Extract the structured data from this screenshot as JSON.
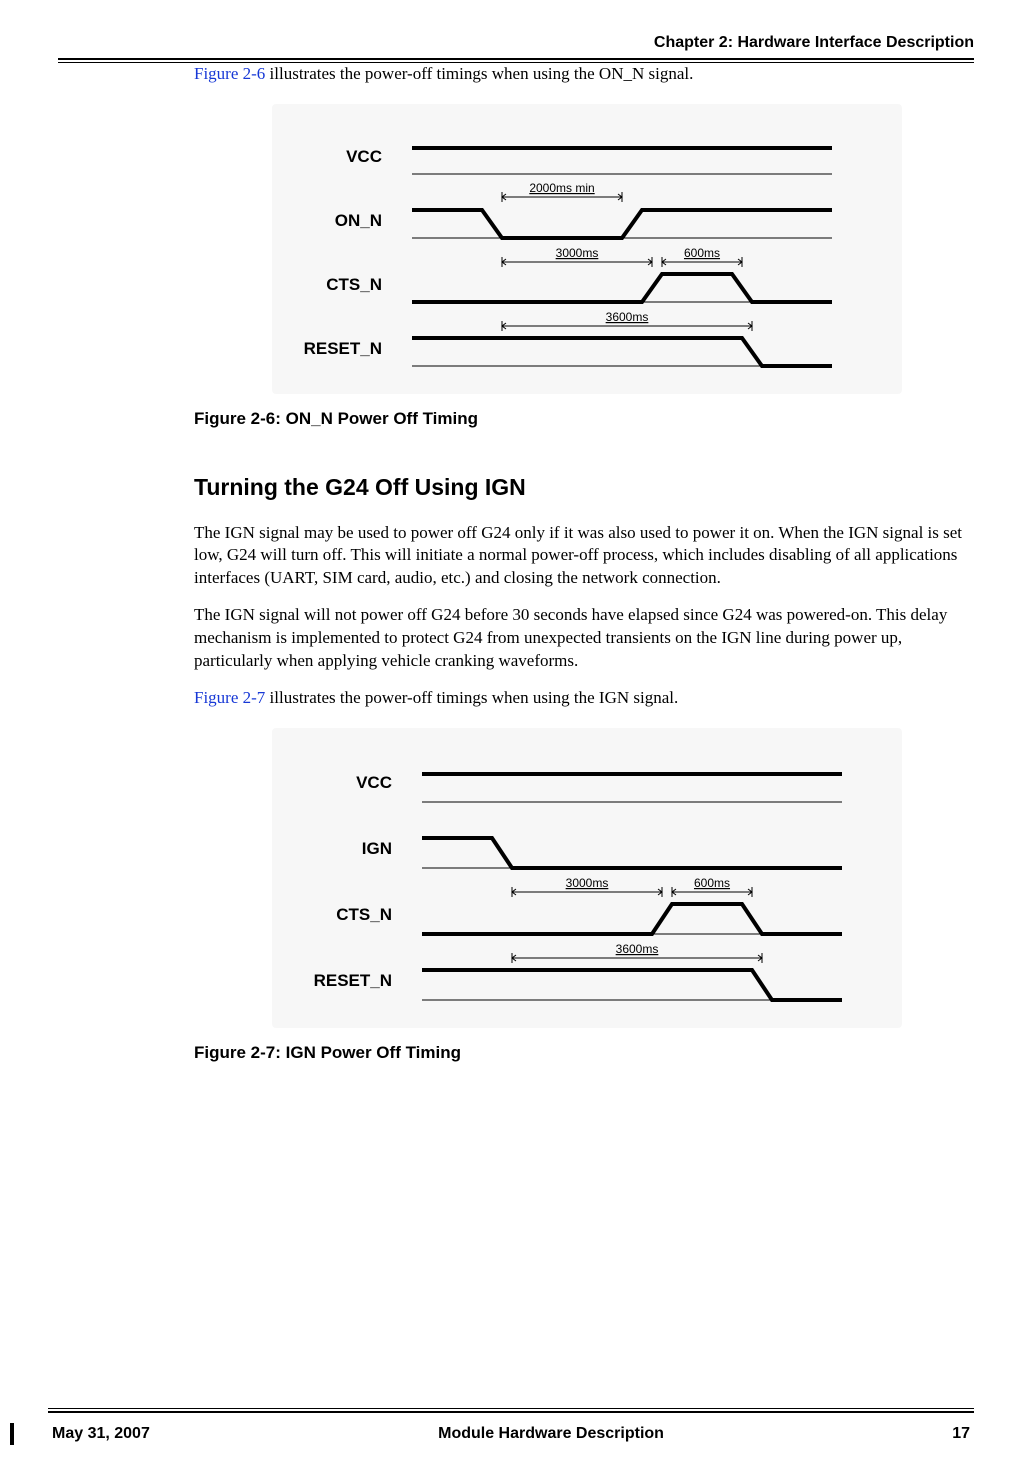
{
  "header": {
    "chapter_label": "Chapter 2:  Hardware Interface Description"
  },
  "intro1": {
    "link": "Figure 2-6",
    "rest": " illustrates the power-off timings when using the ON_N signal."
  },
  "fig26": {
    "caption": "Figure 2-6: ON_N Power Off Timing",
    "signals": [
      "VCC",
      "ON_N",
      "CTS_N",
      "RESET_N"
    ],
    "timings": [
      "2000ms min",
      "3000ms",
      "600ms",
      "3600ms"
    ]
  },
  "section": {
    "title": "Turning the G24 Off Using IGN",
    "p1": "The IGN signal may be used to power off G24 only if it was also used to power it on. When the IGN signal is set low, G24 will turn off. This will initiate a normal power-off process, which includes disabling of all applications interfaces (UART, SIM card, audio, etc.) and closing the network connection.",
    "p2": "The IGN signal will not power off G24 before 30 seconds have elapsed since G24 was powered-on. This delay mechanism is implemented to protect G24 from unexpected transients on the IGN line during power up, particularly when applying vehicle cranking waveforms."
  },
  "intro2": {
    "link": "Figure 2-7",
    "rest": " illustrates the power-off timings when using the IGN signal."
  },
  "fig27": {
    "caption": "Figure 2-7: IGN Power Off Timing",
    "signals": [
      "VCC",
      "IGN",
      "CTS_N",
      "RESET_N"
    ],
    "timings": [
      "3000ms",
      "600ms",
      "3600ms"
    ]
  },
  "footer": {
    "date": "May 31, 2007",
    "title": "Module Hardware Description",
    "page": "17"
  },
  "chart_data": [
    {
      "type": "timing-diagram",
      "title": "ON_N Power Off Timing",
      "signals": [
        {
          "name": "VCC",
          "level": "high-constant"
        },
        {
          "name": "ON_N",
          "events": [
            {
              "t": 0,
              "level": "high"
            },
            {
              "t": 1,
              "level": "low",
              "duration_label": "2000ms min"
            },
            {
              "t": 2,
              "level": "high"
            }
          ]
        },
        {
          "name": "CTS_N",
          "events": [
            {
              "t": 0,
              "level": "low"
            },
            {
              "from": "ON_N-fall",
              "delay_label": "3000ms",
              "level": "high",
              "duration_label": "600ms"
            },
            {
              "level": "low"
            }
          ]
        },
        {
          "name": "RESET_N",
          "events": [
            {
              "t": 0,
              "level": "high"
            },
            {
              "from": "ON_N-fall",
              "delay_label": "3600ms",
              "level": "low"
            }
          ]
        }
      ]
    },
    {
      "type": "timing-diagram",
      "title": "IGN Power Off Timing",
      "signals": [
        {
          "name": "VCC",
          "level": "high-constant"
        },
        {
          "name": "IGN",
          "events": [
            {
              "t": 0,
              "level": "high"
            },
            {
              "t": 1,
              "level": "low"
            }
          ]
        },
        {
          "name": "CTS_N",
          "events": [
            {
              "t": 0,
              "level": "low"
            },
            {
              "from": "IGN-fall",
              "delay_label": "3000ms",
              "level": "high",
              "duration_label": "600ms"
            },
            {
              "level": "low"
            }
          ]
        },
        {
          "name": "RESET_N",
          "events": [
            {
              "t": 0,
              "level": "high"
            },
            {
              "from": "IGN-fall",
              "delay_label": "3600ms",
              "level": "low"
            }
          ]
        }
      ]
    }
  ]
}
